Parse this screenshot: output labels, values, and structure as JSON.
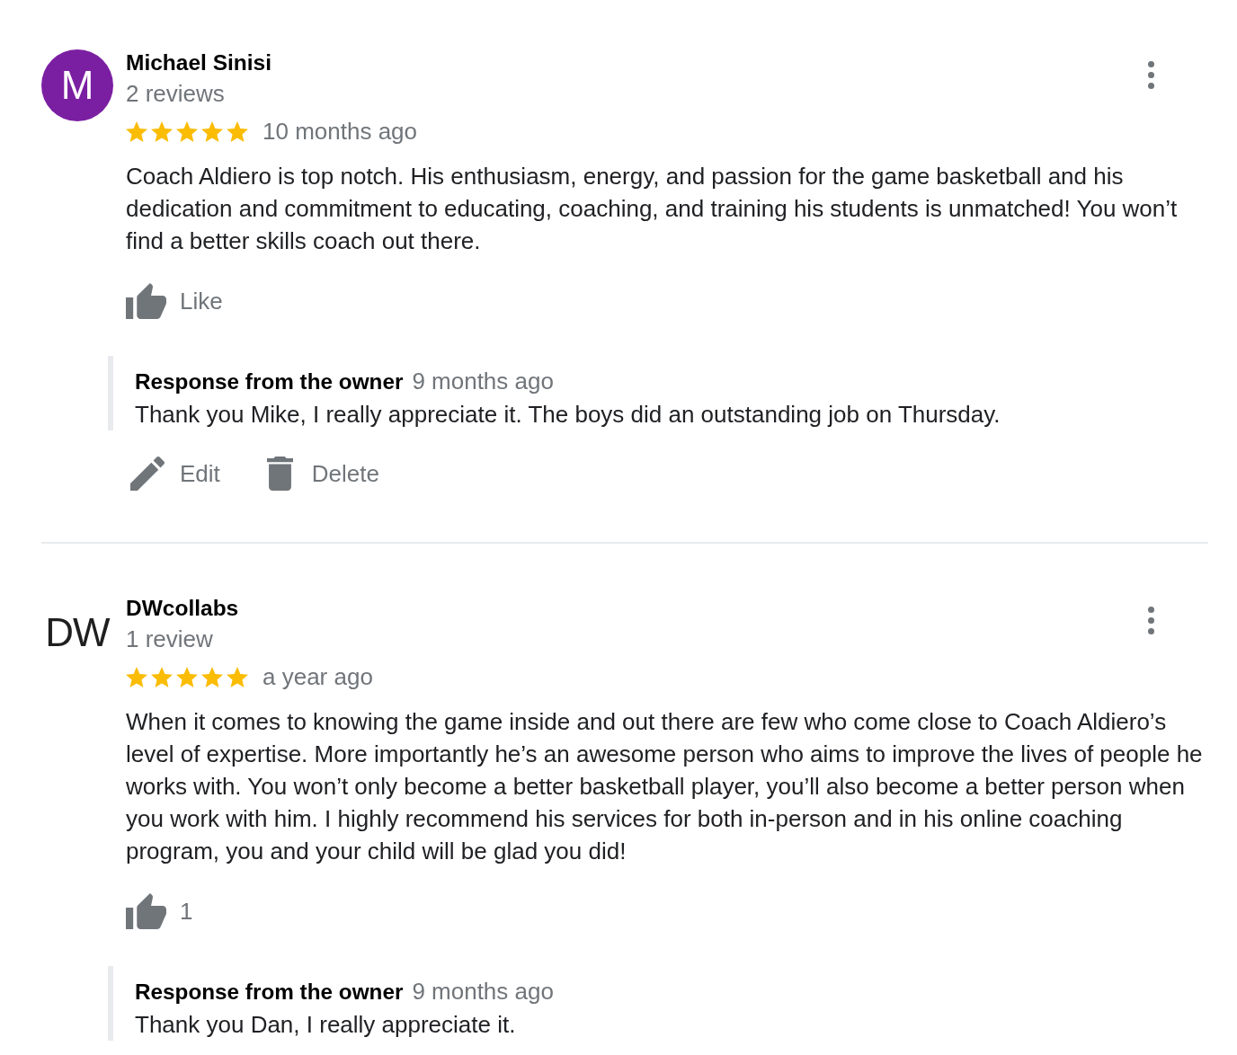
{
  "reviews": [
    {
      "avatar": {
        "kind": "letter",
        "text": "M",
        "color": "#7b1fa2"
      },
      "name": "Michael Sinisi",
      "review_count": "2 reviews",
      "stars": 5,
      "time": "10 months ago",
      "text": "Coach Aldiero is top notch. His enthusiasm, energy, and passion for the game basketball and his dedication and commitment to educating, coaching, and training his students is unmatched! You won’t find a better skills coach out there.",
      "like": {
        "label": "Like"
      },
      "response": {
        "heading": "Response from the owner",
        "time": "9 months ago",
        "text": "Thank you Mike, I really appreciate it. The boys did an outstanding job on Thursday.",
        "actions": [
          {
            "kind": "edit",
            "label": "Edit"
          },
          {
            "kind": "delete",
            "label": "Delete"
          }
        ]
      }
    },
    {
      "avatar": {
        "kind": "logo",
        "text": "DW"
      },
      "name": "DWcollabs",
      "review_count": "1 review",
      "stars": 5,
      "time": "a year ago",
      "text": "When it comes to knowing the game inside and out there are few who come close to Coach Aldiero’s level of expertise. More importantly he’s an awesome person who aims to improve the lives of people he works with. You won’t only become a better basketball player, you’ll also become a better person when you work with him. I highly recommend his services for both in-person and in his online coaching program, you and your child will be glad you did!",
      "like": {
        "label": "1"
      },
      "response": {
        "heading": "Response from the owner",
        "time": "9 months ago",
        "text": "Thank you Dan, I really appreciate it."
      }
    }
  ]
}
